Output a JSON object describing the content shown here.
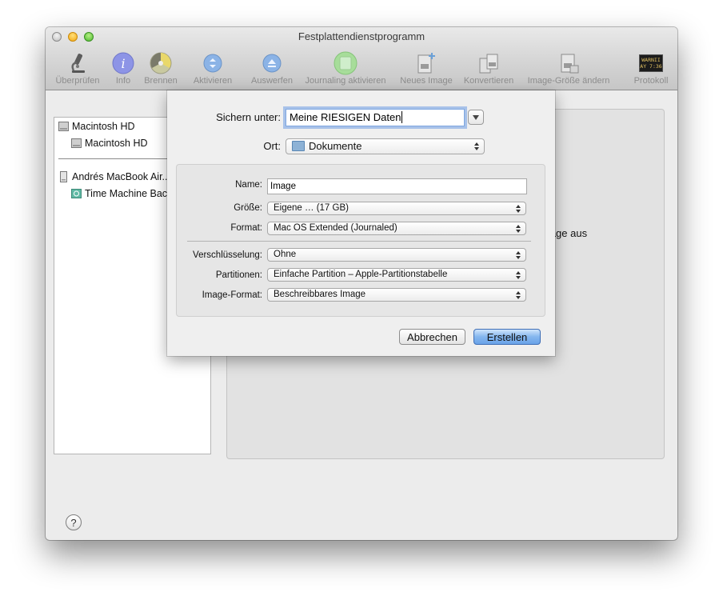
{
  "window": {
    "title": "Festplattendienstprogramm"
  },
  "toolbar": {
    "items": [
      {
        "label": "Überprüfen",
        "icon": "microscope-icon"
      },
      {
        "label": "Info",
        "icon": "info-icon"
      },
      {
        "label": "Brennen",
        "icon": "burn-icon"
      },
      {
        "label": "Aktivieren",
        "icon": "mount-icon"
      },
      {
        "label": "Auswerfen",
        "icon": "eject-icon"
      },
      {
        "label": "Journaling aktivieren",
        "icon": "journaling-icon"
      },
      {
        "label": "Neues Image",
        "icon": "new-image-icon"
      },
      {
        "label": "Konvertieren",
        "icon": "convert-icon"
      },
      {
        "label": "Image-Größe ändern",
        "icon": "resize-image-icon"
      },
      {
        "label": "Protokoll",
        "icon": "log-icon"
      }
    ],
    "log_icon_text": [
      "WARNII",
      "AY 7:36"
    ]
  },
  "sidebar": {
    "items": [
      {
        "label": "Macintosh HD"
      },
      {
        "label": "Macintosh HD"
      },
      {
        "label": "Andrés MacBook Air..."
      },
      {
        "label": "Time Machine Bac..."
      }
    ]
  },
  "main": {
    "partial_text": "mage aus"
  },
  "sheet": {
    "save_as_label": "Sichern unter:",
    "save_as_value": "Meine RIESIGEN Daten",
    "location_label": "Ort:",
    "location_value": "Dokumente",
    "name_label": "Name:",
    "name_value": "Image",
    "size_label": "Größe:",
    "size_value": "Eigene … (17 GB)",
    "format_label": "Format:",
    "format_value": "Mac OS Extended (Journaled)",
    "encryption_label": "Verschlüsselung:",
    "encryption_value": "Ohne",
    "partitions_label": "Partitionen:",
    "partitions_value": "Einfache Partition – Apple-Partitionstabelle",
    "image_format_label": "Image-Format:",
    "image_format_value": "Beschreibbares Image",
    "cancel_label": "Abbrechen",
    "create_label": "Erstellen"
  },
  "help": {
    "label": "?"
  }
}
